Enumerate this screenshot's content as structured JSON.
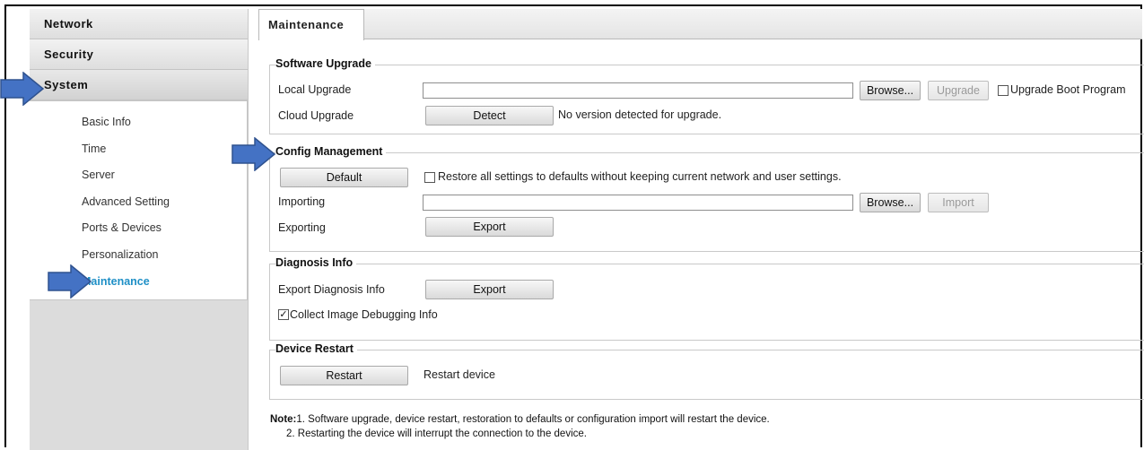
{
  "sidebar": {
    "headers": [
      "Network",
      "Security",
      "System"
    ],
    "items": [
      "Basic Info",
      "Time",
      "Server",
      "Advanced Setting",
      "Ports & Devices",
      "Personalization",
      "Maintenance"
    ],
    "selected": "Maintenance"
  },
  "tab": {
    "label": "Maintenance"
  },
  "software_upgrade": {
    "legend": "Software Upgrade",
    "local_label": "Local Upgrade",
    "local_value": "",
    "browse_label": "Browse...",
    "upgrade_label": "Upgrade",
    "boot_label": "Upgrade Boot Program",
    "boot_checked": false,
    "cloud_label": "Cloud Upgrade",
    "detect_label": "Detect",
    "cloud_status": "No version detected for upgrade."
  },
  "config_management": {
    "legend": "Config Management",
    "default_label": "Default",
    "restore_label": "Restore all settings to defaults without keeping current network and user settings.",
    "restore_checked": false,
    "importing_label": "Importing",
    "import_value": "",
    "browse_label": "Browse...",
    "import_label": "Import",
    "exporting_label": "Exporting",
    "export_label": "Export"
  },
  "diagnosis_info": {
    "legend": "Diagnosis Info",
    "export_diag_label": "Export Diagnosis Info",
    "export_label": "Export",
    "collect_label": "Collect Image Debugging Info",
    "collect_checked": true
  },
  "device_restart": {
    "legend": "Device Restart",
    "restart_label": "Restart",
    "restart_desc": "Restart device"
  },
  "note": {
    "prefix": "Note:",
    "line1": "1. Software upgrade, device restart, restoration to defaults or configuration import will restart the device.",
    "line2": "2. Restarting the device will interrupt the connection to the device."
  },
  "colors": {
    "accent": "#1e8fc6",
    "arrow_fill": "#4472c4",
    "arrow_stroke": "#2f528f"
  }
}
